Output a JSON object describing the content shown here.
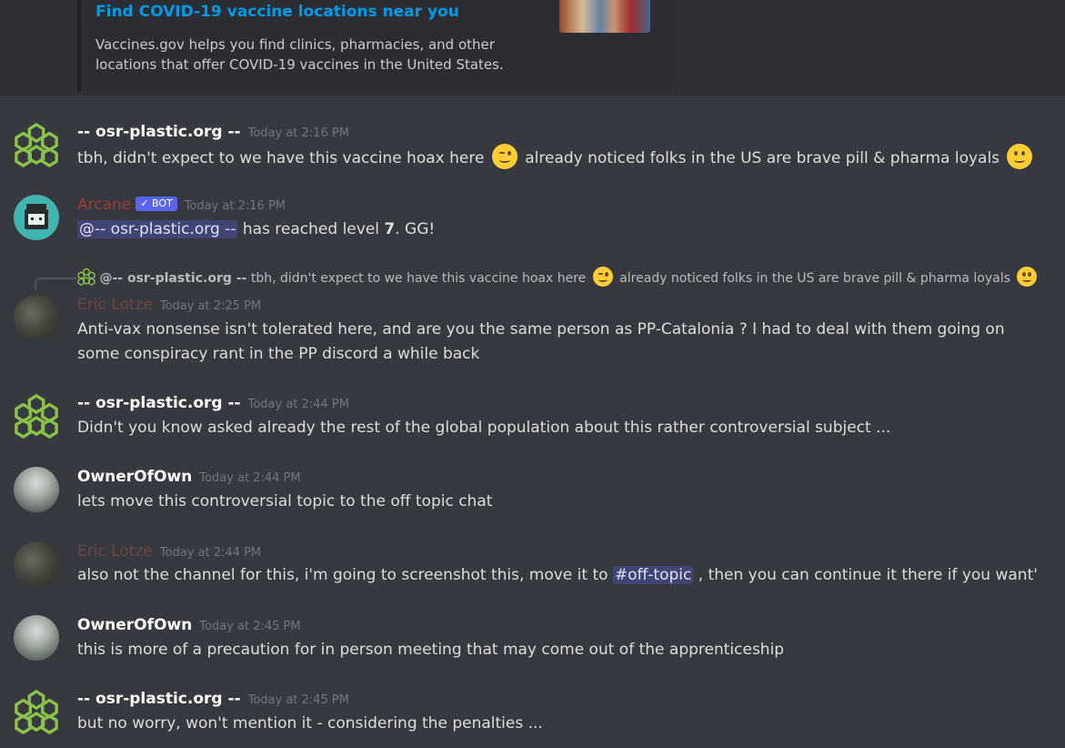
{
  "embed": {
    "title": "Find COVID-19 vaccine locations near you",
    "description": "Vaccines.gov helps you find clinics, pharmacies, and other locations that offer COVID-19 vaccines in the United States."
  },
  "messages": [
    {
      "author": "-- osr-plastic.org --",
      "timestamp": "Today at 2:16 PM",
      "text_a": "tbh, didn't expect to we have this vaccine hoax here",
      "text_b": "already noticed folks in the US are brave pill & pharma loyals",
      "emoji_a": "winking-face-emoji",
      "emoji_b": "slightly-smiling-face-emoji"
    },
    {
      "author": "Arcane",
      "bot_badge": "✓ BOT",
      "timestamp": "Today at 2:16 PM",
      "mention": "@-- osr-plastic.org --",
      "text_a": " has reached level ",
      "level": "7",
      "text_b": ". GG!"
    },
    {
      "reply_author": "@-- osr-plastic.org --",
      "reply_text_a": "tbh, didn't expect to we have this vaccine hoax here",
      "reply_text_b": "already noticed folks in the US are brave pill & pharma loyals",
      "author": "Eric Lotze",
      "timestamp": "Today at 2:25 PM",
      "text": "Anti-vax nonsense isn't tolerated here, and are you the same person as PP-Catalonia ?  I had to deal with them going on some conspiracy rant in the PP discord a while back"
    },
    {
      "author": "-- osr-plastic.org --",
      "timestamp": "Today at 2:44 PM",
      "text": "Didn't you know asked already the rest of the global population about this rather controversial subject  ..."
    },
    {
      "author": "OwnerOfOwn",
      "timestamp": "Today at 2:44 PM",
      "text": "lets move this controversial topic to the off topic chat"
    },
    {
      "author": "Eric Lotze",
      "timestamp": "Today at 2:44 PM",
      "text_a": "also not the channel for this, i'm going to screenshot this, move it to ",
      "channel": "#off-topic",
      "text_b": " , then you can continue it there if you want'"
    },
    {
      "author": "OwnerOfOwn",
      "timestamp": "Today at 2:45 PM",
      "text": "this is more of a precaution for in person meeting that may come out of the apprenticeship"
    },
    {
      "author": "-- osr-plastic.org --",
      "timestamp": "Today at 2:45 PM",
      "text": "but no worry, won't mention it - considering the penalties ..."
    }
  ],
  "colors": {
    "background": "#36393f",
    "link": "#00a8fc",
    "bot_badge": "#5865f2",
    "osr_logo": "#8bc34a"
  }
}
